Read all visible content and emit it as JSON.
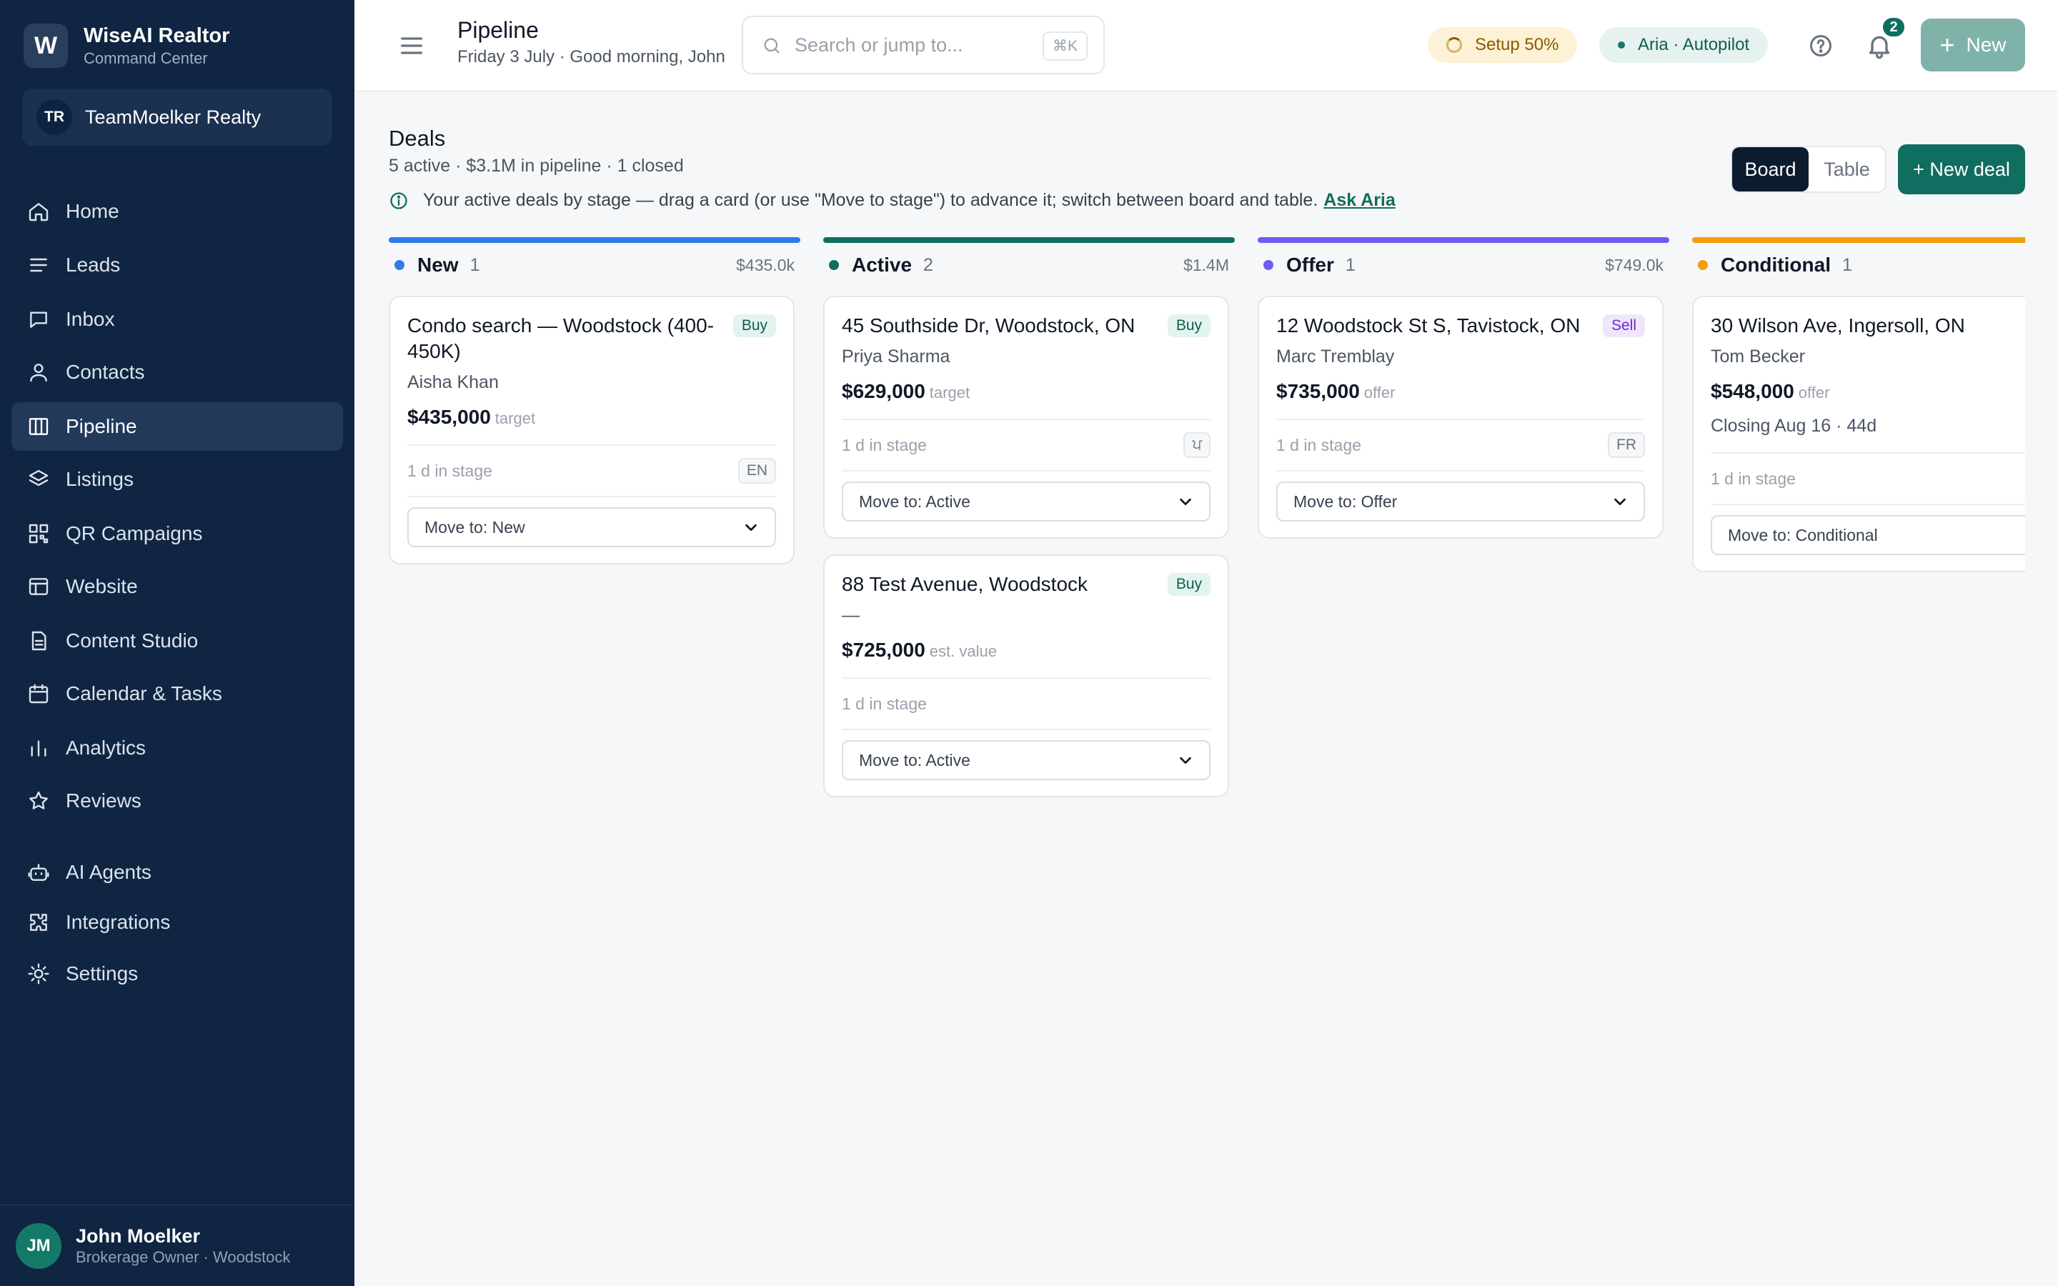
{
  "sidebar": {
    "brand_initial": "W",
    "brand_name": "WiseAI Realtor",
    "brand_sub": "Command Center",
    "team_initials": "TR",
    "team_name": "TeamMoelker Realty",
    "items": [
      {
        "label": "Home",
        "icon": "home-icon"
      },
      {
        "label": "Leads",
        "icon": "list-icon"
      },
      {
        "label": "Inbox",
        "icon": "message-icon"
      },
      {
        "label": "Contacts",
        "icon": "user-icon"
      },
      {
        "label": "Pipeline",
        "icon": "columns-icon",
        "active": true
      },
      {
        "label": "Listings",
        "icon": "layers-icon"
      },
      {
        "label": "QR Campaigns",
        "icon": "qr-icon"
      },
      {
        "label": "Website",
        "icon": "layout-icon"
      },
      {
        "label": "Content Studio",
        "icon": "document-icon"
      },
      {
        "label": "Calendar & Tasks",
        "icon": "calendar-icon"
      },
      {
        "label": "Analytics",
        "icon": "bar-chart-icon"
      },
      {
        "label": "Reviews",
        "icon": "star-icon"
      },
      {
        "label": "AI Agents",
        "icon": "robot-icon"
      },
      {
        "label": "Integrations",
        "icon": "puzzle-icon"
      },
      {
        "label": "Settings",
        "icon": "sun-icon"
      }
    ],
    "user": {
      "initials": "JM",
      "name": "John Moelker",
      "role": "Brokerage Owner · Woodstock"
    }
  },
  "topbar": {
    "title": "Pipeline",
    "subtitle": "Friday 3 July · Good morning, John",
    "search_placeholder": "Search or jump to...",
    "search_shortcut": "⌘K",
    "setup_label": "Setup 50%",
    "aria_label": "Aria · Autopilot",
    "notification_count": "2",
    "new_label": "New"
  },
  "deals": {
    "title": "Deals",
    "summary": "5 active · $3.1M in pipeline · 1 closed",
    "hint": "Your active deals by stage — drag a card (or use \"Move to stage\") to advance it; switch between board and table.",
    "ask_aria": "Ask Aria",
    "view_board": "Board",
    "view_table": "Table",
    "new_deal": "+ New deal"
  },
  "columns": [
    {
      "name": "New",
      "count": "1",
      "total": "$435.0k",
      "color": "#2f7be8",
      "cards": [
        {
          "title": "Condo search — Woodstock (400-450K)",
          "tag": "Buy",
          "contact": "Aisha Khan",
          "price": "$435,000",
          "price_unit": "target",
          "age": "1 d in stage",
          "lang": "EN",
          "move": "Move to: New"
        }
      ]
    },
    {
      "name": "Active",
      "count": "2",
      "total": "$1.4M",
      "color": "#0f6e60",
      "cards": [
        {
          "title": "45 Southside Dr, Woodstock, ON",
          "tag": "Buy",
          "contact": "Priya Sharma",
          "price": "$629,000",
          "price_unit": "target",
          "age": "1 d in stage",
          "lang": "ਪ",
          "move": "Move to: Active"
        },
        {
          "title": "88 Test Avenue, Woodstock",
          "tag": "Buy",
          "contact": "—",
          "price": "$725,000",
          "price_unit": "est. value",
          "age": "1 d in stage",
          "move": "Move to: Active"
        }
      ]
    },
    {
      "name": "Offer",
      "count": "1",
      "total": "$749.0k",
      "color": "#6d5cf0",
      "cards": [
        {
          "title": "12 Woodstock St S, Tavistock, ON",
          "tag": "Sell",
          "contact": "Marc Tremblay",
          "price": "$735,000",
          "price_unit": "offer",
          "age": "1 d in stage",
          "lang": "FR",
          "move": "Move to: Offer"
        }
      ]
    },
    {
      "name": "Conditional",
      "count": "1",
      "total": "",
      "color": "#f59e0b",
      "cards": [
        {
          "title": "30 Wilson Ave, Ingersoll, ON",
          "tag": "",
          "contact": "Tom Becker",
          "price": "$548,000",
          "price_unit": "offer",
          "closing": "Closing Aug 16 · 44d",
          "age": "1 d in stage",
          "move": "Move to: Conditional"
        }
      ]
    }
  ]
}
